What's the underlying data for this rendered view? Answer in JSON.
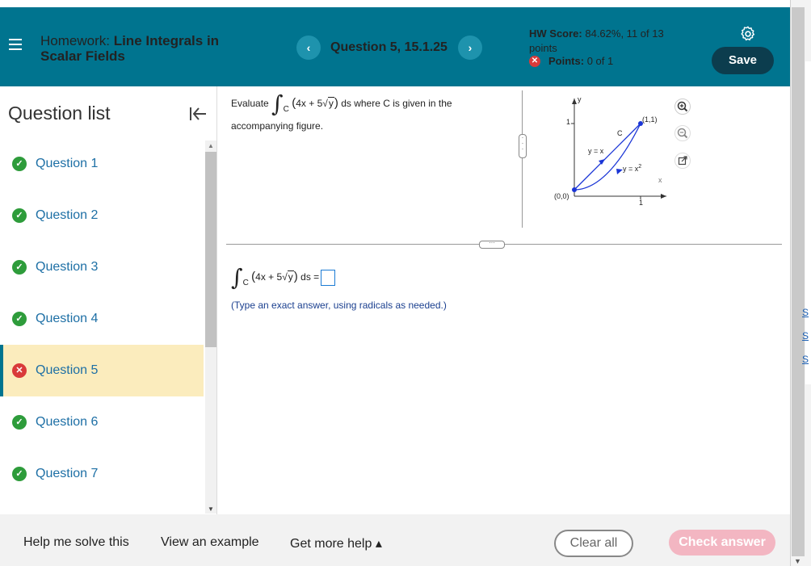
{
  "header": {
    "title_prefix": "Homework:",
    "title_main": "Line Integrals in",
    "title_line2": "Scalar Fields",
    "question_label": "Question 5, 15.1.25",
    "hw_score_label": "HW Score:",
    "hw_score_value": "84.62%, 11 of 13",
    "hw_score_line2": "points",
    "points_label": "Points:",
    "points_value": "0 of 1",
    "save_label": "Save",
    "prev_glyph": "‹",
    "next_glyph": "›"
  },
  "sidebar": {
    "title": "Question list",
    "items": [
      {
        "label": "Question 1",
        "status": "correct"
      },
      {
        "label": "Question 2",
        "status": "correct"
      },
      {
        "label": "Question 3",
        "status": "correct"
      },
      {
        "label": "Question 4",
        "status": "correct"
      },
      {
        "label": "Question 5",
        "status": "incorrect"
      },
      {
        "label": "Question 6",
        "status": "correct"
      },
      {
        "label": "Question 7",
        "status": "correct"
      }
    ]
  },
  "question": {
    "evaluate": "Evaluate",
    "sub_c": "C",
    "integrand_a": "4x + 5",
    "integrand_sqrt": "y",
    "after": "ds where C is given in the",
    "line2": "accompanying figure.",
    "answer_ds": "ds =",
    "hint": "(Type an exact answer, using radicals as needed.)"
  },
  "figure": {
    "axis_y": "y",
    "axis_x": "x",
    "tick_y": "1",
    "tick_x": "1",
    "origin": "(0,0)",
    "point": "(1,1)",
    "curve_label": "C",
    "line_label": "y = x",
    "parabola_label": "y = x",
    "parabola_exp": "2"
  },
  "footer": {
    "help": "Help me solve this",
    "example": "View an example",
    "more_help": "Get more help ▴",
    "clear": "Clear all",
    "check": "Check answer"
  },
  "edge_links": [
    "S",
    "S",
    "S"
  ],
  "colors": {
    "header_bg": "#00748f",
    "save_bg": "#0c3d4e",
    "correct": "#2e9c3b",
    "incorrect": "#d93a3a",
    "active_row": "#fbecbd",
    "check_btn": "#f3b6c2"
  }
}
